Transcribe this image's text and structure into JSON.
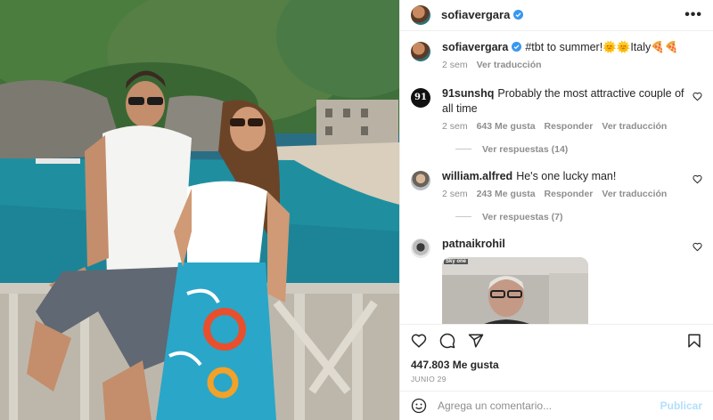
{
  "header": {
    "username": "sofiavergara",
    "more_label": "•••"
  },
  "caption": {
    "username": "sofiavergara",
    "text": "#tbt to summer!🌞🌞Italy🍕🍕",
    "time": "2 sem",
    "translate": "Ver traducción"
  },
  "comments": [
    {
      "username": "91sunshq",
      "avatar_text": "91",
      "text": "Probably the most attractive couple of all time",
      "time": "2 sem",
      "likes": "643 Me gusta",
      "reply": "Responder",
      "translate": "Ver traducción",
      "replies": "Ver respuestas (14)"
    },
    {
      "username": "william.alfred",
      "text": "He's one lucky man!",
      "time": "2 sem",
      "likes": "243 Me gusta",
      "reply": "Responder",
      "translate": "Ver traducción",
      "replies": "Ver respuestas (7)"
    },
    {
      "username": "patnaikrohil",
      "text": "",
      "gif_badge": "Sky one"
    }
  ],
  "post": {
    "likes": "447.803 Me gusta",
    "date": "JUNIO 29"
  },
  "comment_box": {
    "placeholder": "Agrega un comentario...",
    "publish": "Publicar"
  },
  "icons": [
    "heart-icon",
    "comment-icon",
    "share-icon",
    "bookmark-icon",
    "emoji-icon",
    "verified-icon",
    "more-icon"
  ],
  "colors": {
    "verified": "#3897f0",
    "muted": "#8e8e8e",
    "publish": "#b2dffc"
  }
}
